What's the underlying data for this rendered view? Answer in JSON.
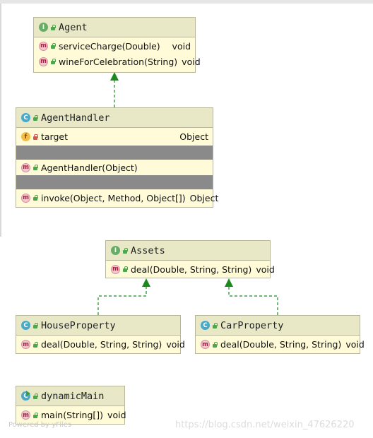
{
  "classes": {
    "agent": {
      "name": "Agent",
      "badge": "I",
      "methods": [
        {
          "name": "serviceCharge(Double)",
          "type": "void"
        },
        {
          "name": "wineForCelebration(String)",
          "type": "void"
        }
      ]
    },
    "agent_handler": {
      "name": "AgentHandler",
      "badge": "C",
      "fields": [
        {
          "name": "target",
          "type": "Object"
        }
      ],
      "constructors": [
        {
          "name": "AgentHandler(Object)",
          "type": ""
        }
      ],
      "methods": [
        {
          "name": "invoke(Object, Method, Object[])",
          "type": "Object"
        }
      ]
    },
    "assets": {
      "name": "Assets",
      "badge": "I",
      "methods": [
        {
          "name": "deal(Double, String, String)",
          "type": "void"
        }
      ]
    },
    "house_property": {
      "name": "HouseProperty",
      "badge": "C",
      "methods": [
        {
          "name": "deal(Double, String, String)",
          "type": "void"
        }
      ]
    },
    "car_property": {
      "name": "CarProperty",
      "badge": "C",
      "methods": [
        {
          "name": "deal(Double, String, String)",
          "type": "void"
        }
      ]
    },
    "dynamic_main": {
      "name": "dynamicMain",
      "badge": "C",
      "methods": [
        {
          "name": "main(String[])",
          "type": "void"
        }
      ]
    }
  },
  "badges": {
    "method": "m",
    "field": "f"
  },
  "colors": {
    "class_body": "#fffbd9",
    "class_header": "#e8e8c6",
    "arrow": "#1a8a1a"
  },
  "footer": {
    "left": "Powered by yFiles",
    "right": "https://blog.csdn.net/weixin_47626220"
  }
}
